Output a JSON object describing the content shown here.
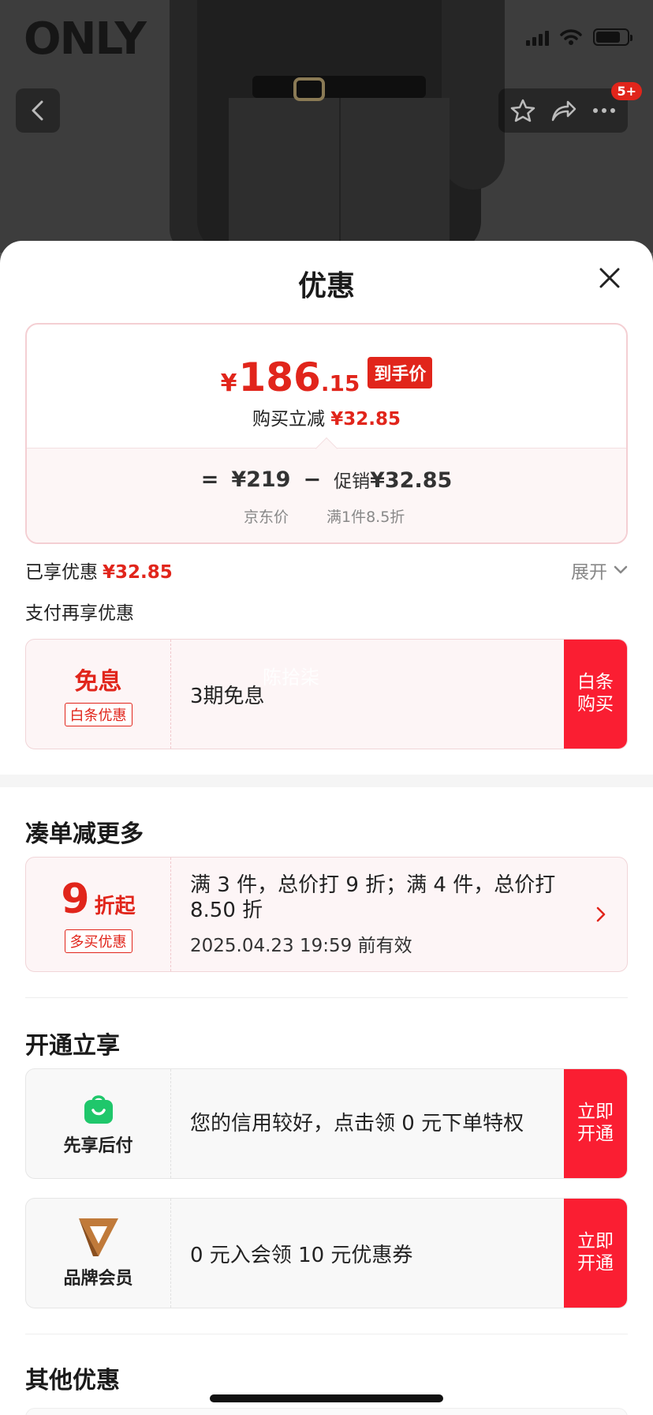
{
  "hero": {
    "brand": "ONLY",
    "cart_badge": "5+"
  },
  "sheet": {
    "title": "优惠",
    "price_card": {
      "yen": "¥",
      "price_int": "186",
      "price_dec": ".15",
      "price_tag": "到手价",
      "buy_off_label": "购买立减",
      "buy_off_value": "¥32.85",
      "equals": "=",
      "jd_price": "¥219",
      "minus": "−",
      "promo_label": "促销",
      "promo_value": "¥32.85",
      "jd_price_label": "京东价",
      "promo_rule": "满1件8.5折"
    },
    "enjoyed_label": "已享优惠",
    "enjoyed_value": "¥32.85",
    "expand_label": "展开",
    "pay_more_label": "支付再享优惠",
    "baitiao": {
      "title": "免息",
      "tag": "白条优惠",
      "desc": "3期免息",
      "watermark": "陈拾柒",
      "action": "白条购买"
    },
    "combine_section": {
      "title": "凑单减更多",
      "num": "9",
      "num_suffix": "折起",
      "tag": "多买优惠",
      "desc": "满 3 件，总价打 9 折；满 4 件，总价打 8.50 折",
      "valid": "2025.04.23 19:59 前有效"
    },
    "open_section": {
      "title": "开通立享",
      "items": [
        {
          "label": "先享后付",
          "icon": "shopping-bag-icon",
          "desc": "您的信用较好，点击领 0 元下单特权",
          "action": "立即开通"
        },
        {
          "label": "品牌会员",
          "icon": "brand-v-icon",
          "desc": "0 元入会领 10 元优惠券",
          "action": "立即开通"
        }
      ]
    },
    "other_section": {
      "title": "其他优惠"
    }
  },
  "colors": {
    "accent": "#e1251b",
    "action_bg": "#fa1e32",
    "green": "#1fc76b",
    "brand_gold": "#c07a3a"
  }
}
